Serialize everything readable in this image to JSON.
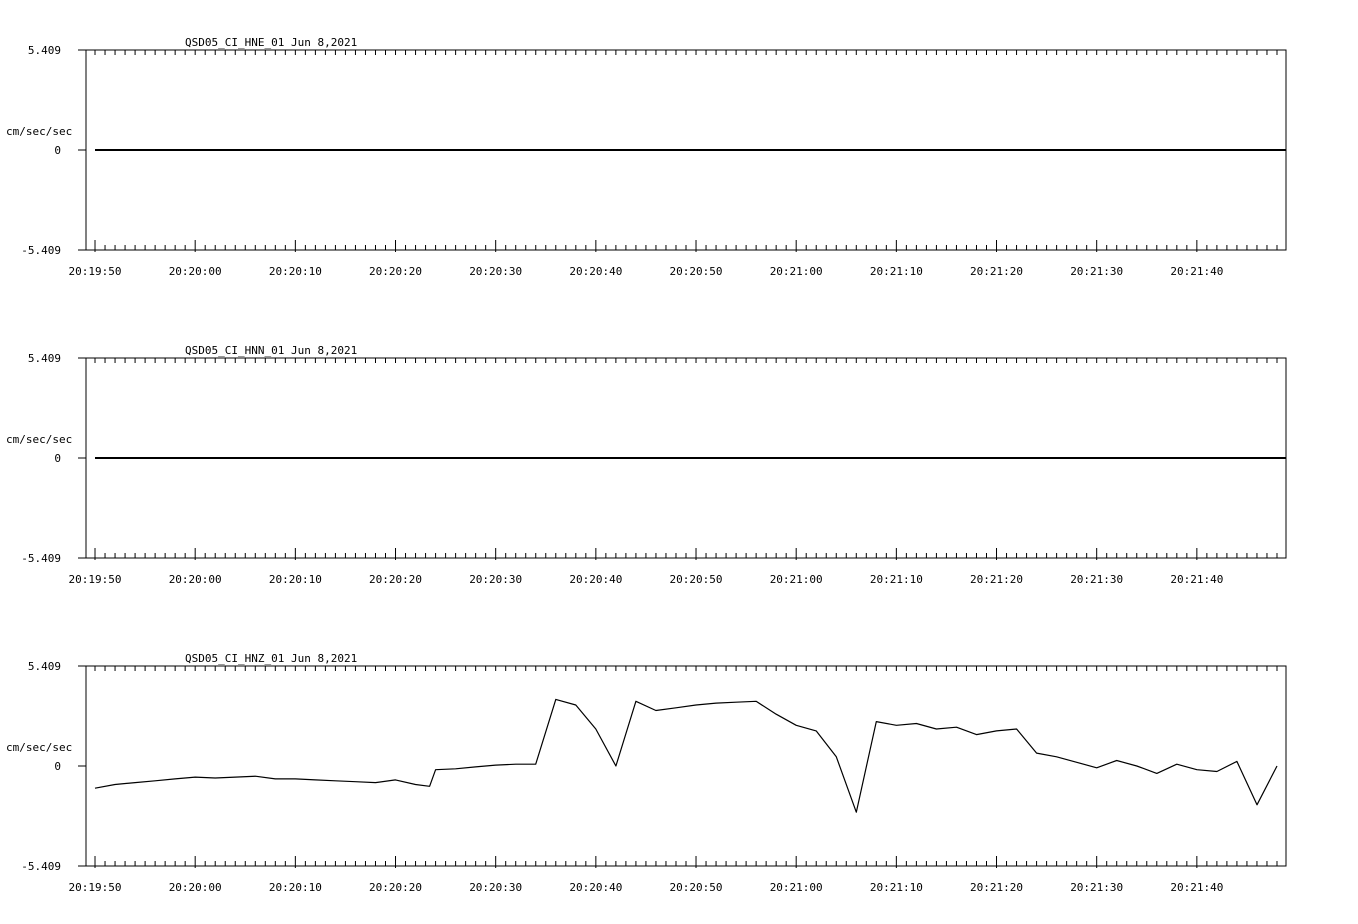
{
  "chart_data": [
    {
      "type": "line",
      "title": "QSD05_CI_HNE_01  Jun 8,2021",
      "ylabel": "cm/sec/sec",
      "ylim": [
        -5.409,
        5.409
      ],
      "yticks": [
        "5.409",
        "0",
        "-5.409"
      ],
      "xticks": [
        "20:19:50",
        "20:20:00",
        "20:20:10",
        "20:20:20",
        "20:20:30",
        "20:20:40",
        "20:20:50",
        "20:21:00",
        "20:21:10",
        "20:21:20",
        "20:21:30",
        "20:21:40"
      ],
      "xlim_seconds_from_first_tick": [
        -0.9,
        118.9
      ],
      "series": [
        {
          "x": [
            0,
            118.9
          ],
          "y": [
            0,
            0
          ]
        }
      ]
    },
    {
      "type": "line",
      "title": "QSD05_CI_HNN_01  Jun 8,2021",
      "ylabel": "cm/sec/sec",
      "ylim": [
        -5.409,
        5.409
      ],
      "yticks": [
        "5.409",
        "0",
        "-5.409"
      ],
      "xticks": [
        "20:19:50",
        "20:20:00",
        "20:20:10",
        "20:20:20",
        "20:20:30",
        "20:20:40",
        "20:20:50",
        "20:21:00",
        "20:21:10",
        "20:21:20",
        "20:21:30",
        "20:21:40"
      ],
      "xlim_seconds_from_first_tick": [
        -0.9,
        118.9
      ],
      "series": [
        {
          "x": [
            0,
            118.9
          ],
          "y": [
            0,
            0
          ]
        }
      ]
    },
    {
      "type": "line",
      "title": "QSD05_CI_HNZ_01  Jun 8,2021",
      "ylabel": "cm/sec/sec",
      "ylim": [
        -5.409,
        5.409
      ],
      "yticks": [
        "5.409",
        "0",
        "-5.409"
      ],
      "xticks": [
        "20:19:50",
        "20:20:00",
        "20:20:10",
        "20:20:20",
        "20:20:30",
        "20:20:40",
        "20:20:50",
        "20:21:00",
        "20:21:10",
        "20:21:20",
        "20:21:30",
        "20:21:40"
      ],
      "xlim_seconds_from_first_tick": [
        -0.9,
        118.9
      ],
      "series": [
        {
          "x": [
            0,
            2,
            4,
            6,
            8,
            10,
            12,
            14,
            16,
            18,
            20,
            22,
            24,
            26,
            28,
            30,
            32,
            33.4,
            34,
            36,
            38,
            40,
            42,
            44,
            46,
            48,
            50,
            52,
            54,
            56,
            58,
            60,
            62,
            64,
            66,
            68,
            70,
            72,
            74,
            76,
            78,
            80,
            82,
            84,
            86,
            88,
            90,
            92,
            94,
            96,
            98,
            100,
            102,
            104,
            106,
            108,
            110,
            112,
            114,
            116,
            118
          ],
          "y": [
            -1.2,
            -1.0,
            -0.9,
            -0.8,
            -0.7,
            -0.6,
            -0.65,
            -0.6,
            -0.55,
            -0.7,
            -0.7,
            -0.75,
            -0.8,
            -0.85,
            -0.9,
            -0.75,
            -1.0,
            -1.1,
            -0.2,
            -0.15,
            -0.05,
            0.05,
            0.1,
            0.1,
            3.6,
            3.3,
            2.0,
            0.0,
            3.5,
            3.0,
            3.15,
            3.3,
            3.4,
            3.45,
            3.5,
            2.8,
            2.2,
            1.9,
            0.5,
            -2.5,
            2.4,
            2.2,
            2.3,
            2.0,
            2.1,
            1.7,
            1.9,
            2.0,
            0.7,
            0.5,
            0.2,
            -0.1,
            0.3,
            0.0,
            -0.4,
            0.1,
            -0.2,
            -0.3,
            0.25,
            -2.1,
            0.0
          ]
        }
      ]
    }
  ]
}
